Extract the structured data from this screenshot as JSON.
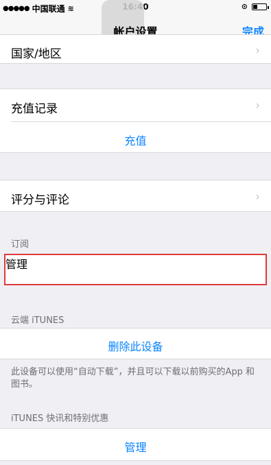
{
  "status_bar": {
    "carrier_signal": "●●●●●",
    "carrier": "中国联通",
    "wifi_icon": "wifi-icon",
    "time": "16:40"
  },
  "nav": {
    "title": "帐户设置",
    "done_label": "完成"
  },
  "rows": {
    "country_region": "国家/地区",
    "purchase_history": "充值记录",
    "top_up": "充值",
    "ratings_reviews": "评分与评论"
  },
  "subscriptions": {
    "header": "订阅",
    "manage_label": "管理"
  },
  "itunes_cloud": {
    "header": "云端 iTUNES",
    "remove_device_label": "删除此设备",
    "footnote": "此设备可以使用“自动下载”，并且可以下载以前购买的App 和图书。"
  },
  "newsletters": {
    "header": "iTUNES 快讯和特别优惠",
    "manage_label": "管理"
  },
  "colors": {
    "accent": "#0a84ff",
    "highlight_border": "#e03a3a",
    "background": "#efeff4"
  }
}
